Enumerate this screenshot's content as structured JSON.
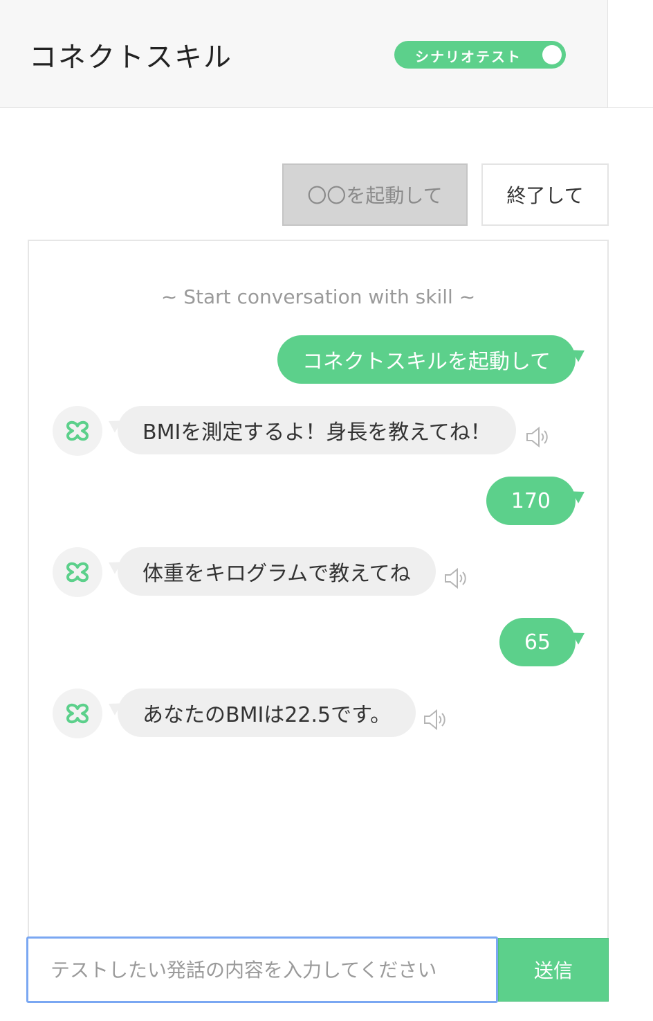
{
  "header": {
    "title": "コネクトスキル",
    "toggle_label": "シナリオテスト"
  },
  "quick_buttons": {
    "launch_label": "〇〇を起動して",
    "end_label": "終了して"
  },
  "chat": {
    "start_text": "~ Start conversation with skill ~",
    "messages": [
      {
        "sender": "user",
        "text": "コネクトスキルを起動して"
      },
      {
        "sender": "bot",
        "text": "BMIを測定するよ！身長を教えてね！"
      },
      {
        "sender": "user",
        "text": "170"
      },
      {
        "sender": "bot",
        "text": "体重をキログラムで教えてね"
      },
      {
        "sender": "user",
        "text": "65"
      },
      {
        "sender": "bot",
        "text": "あなたのBMIは22.5です。"
      }
    ]
  },
  "composer": {
    "placeholder": "テストしたい発話の内容を入力してください",
    "send_label": "送信"
  },
  "colors": {
    "accent": "#5cd08b",
    "bot_bubble": "#efefef",
    "input_focus": "#7aa7f2"
  }
}
